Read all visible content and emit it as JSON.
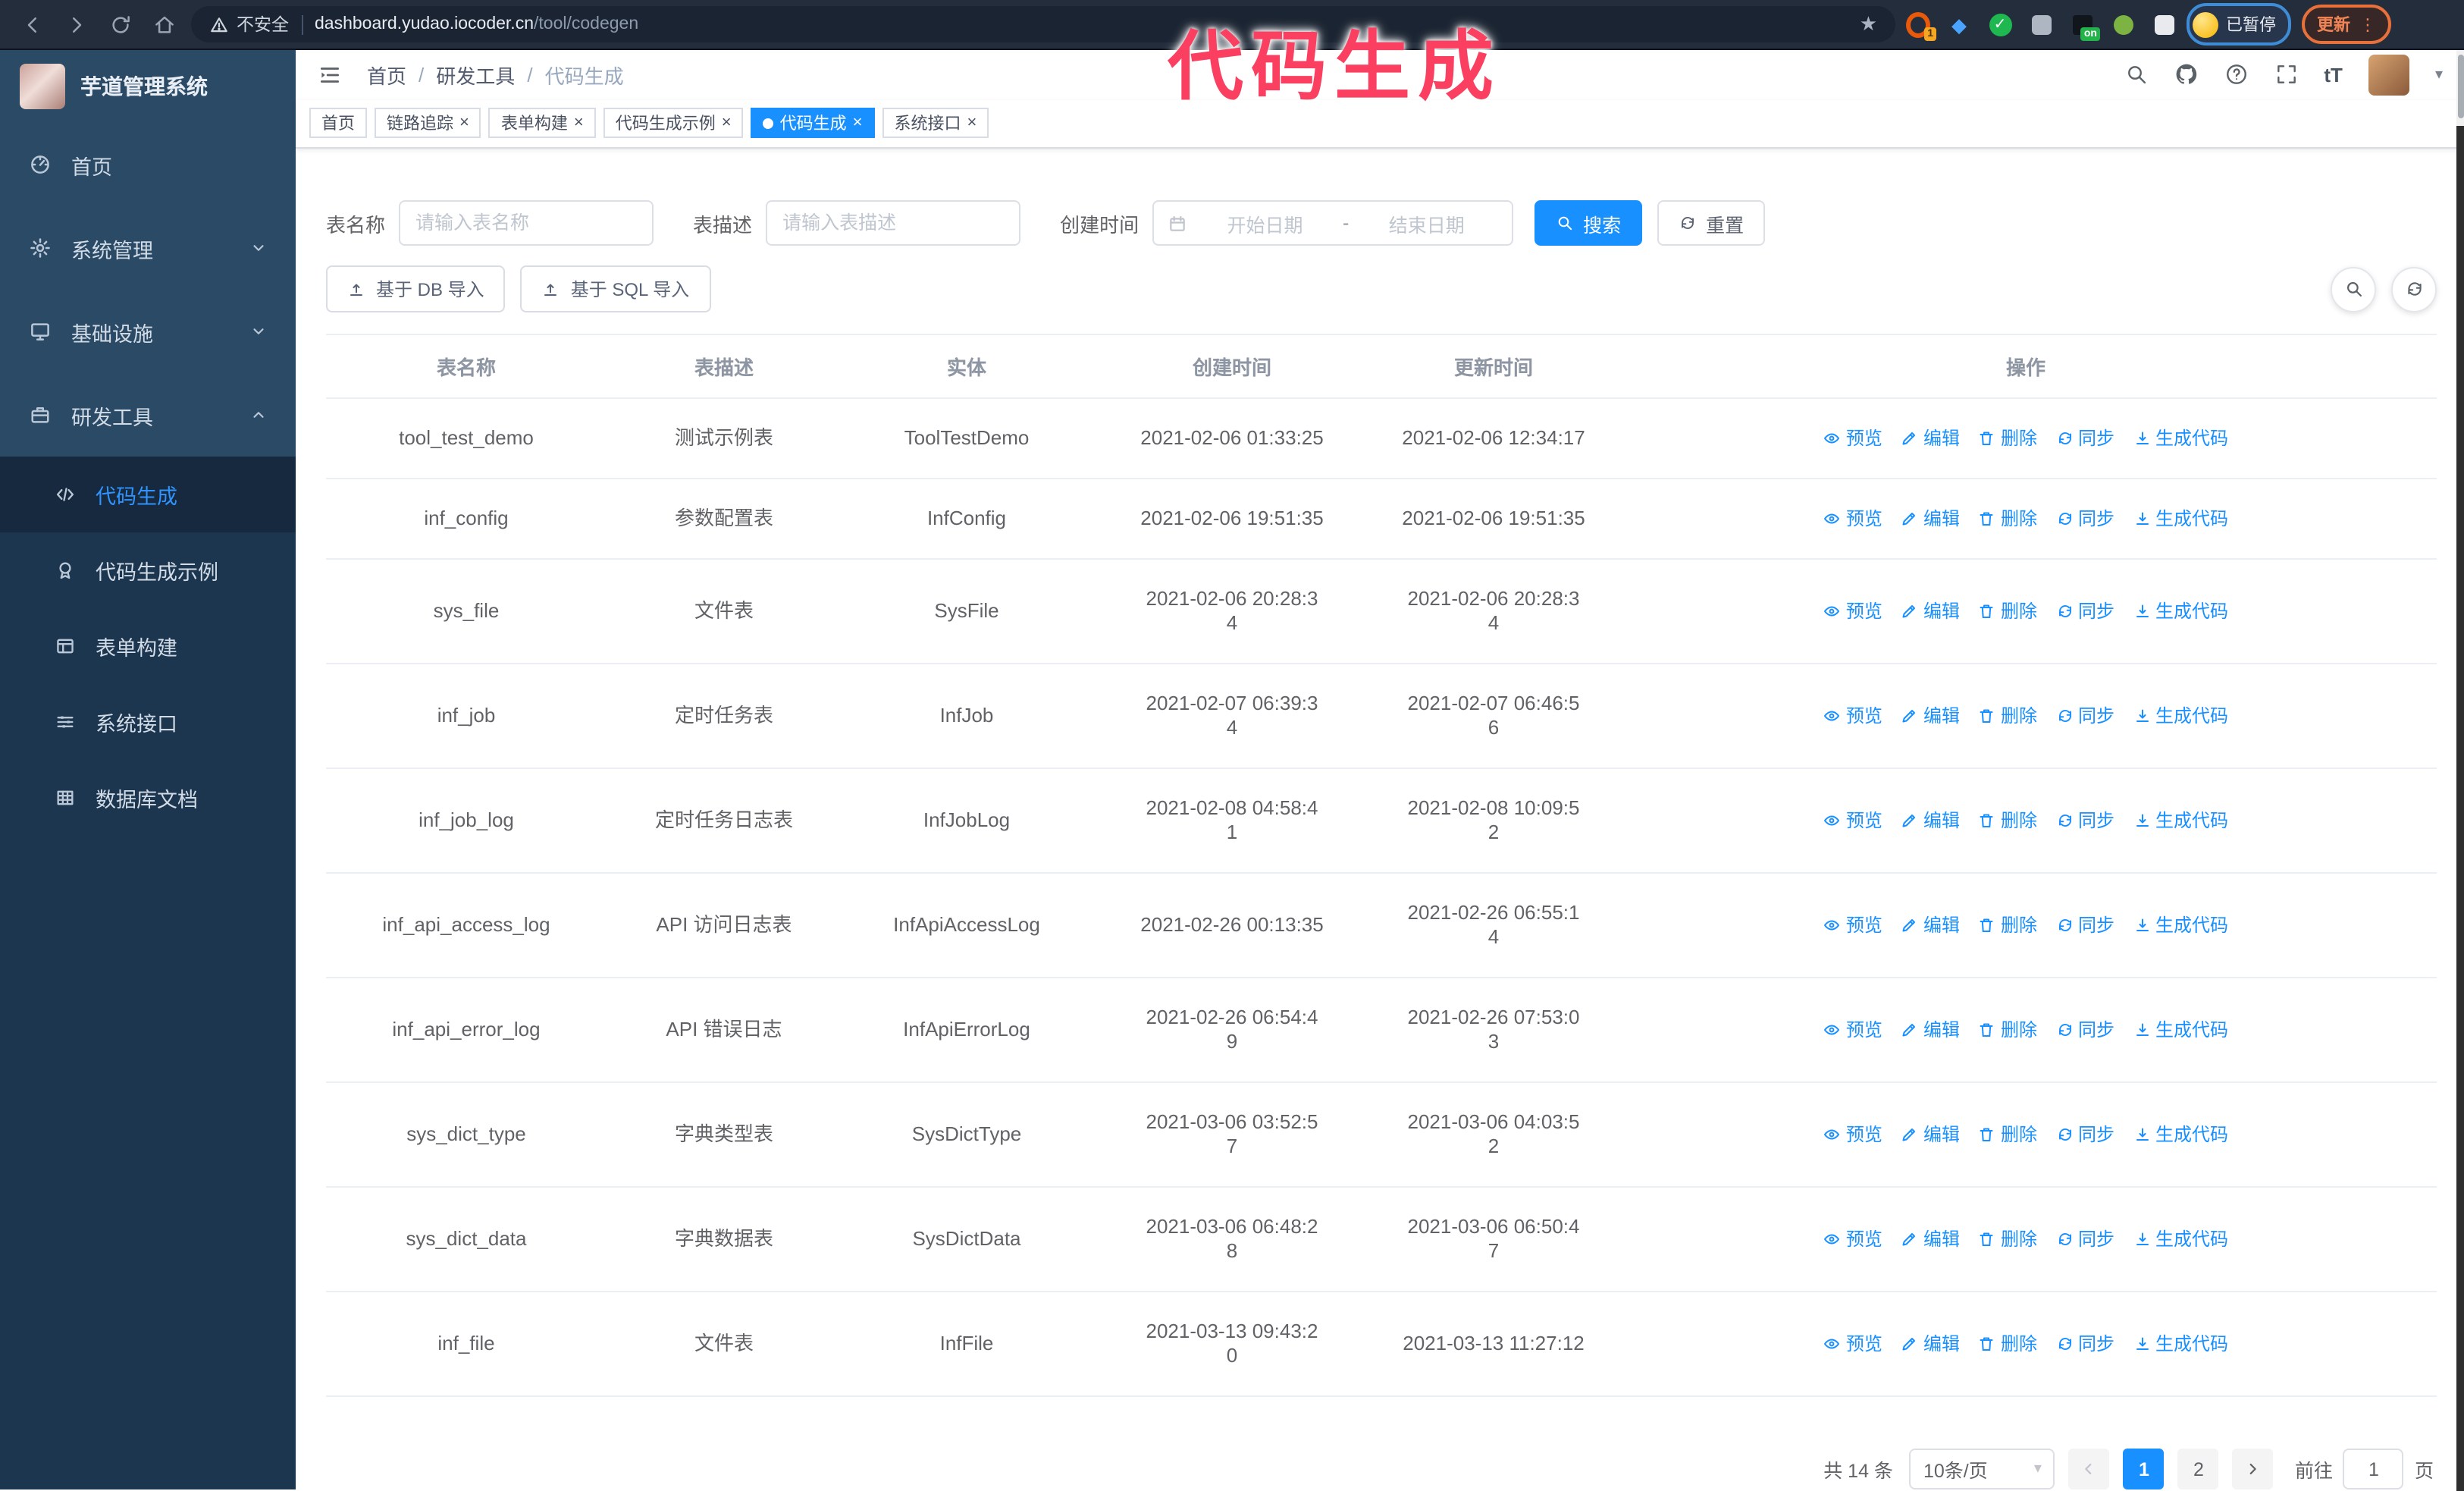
{
  "colors": {
    "accent": "#1890ff",
    "annotation_pink": "#fa3f60",
    "sidebar_bg": "#2b4a66",
    "submenu_bg": "#1d3650",
    "browser_bar": "#232d3c"
  },
  "icons": {
    "close": "×",
    "caret_down": "▾",
    "back_arrow": "←",
    "forward_arrow": "→",
    "star": "★",
    "font_size": "tT",
    "kebab_dots": "⋮",
    "check": "✓",
    "dot_diamond": "◆"
  },
  "browser": {
    "security_warning": "不安全",
    "url_domain": "dashboard.yudao.iocoder.cn",
    "url_path": "/tool/codegen",
    "ext_badge": "1",
    "ext_on_badge": "on",
    "paused_badge": "已暂停",
    "update_button": "更新"
  },
  "annotation": {
    "text": "代码生成"
  },
  "sidebar": {
    "logo_title": "芋道管理系统",
    "items": [
      {
        "label": "首页",
        "icon": "dashboard-icon",
        "chevron": ""
      },
      {
        "label": "系统管理",
        "icon": "gear-icon",
        "chevron": "down"
      },
      {
        "label": "基础设施",
        "icon": "monitor-icon",
        "chevron": "down"
      },
      {
        "label": "研发工具",
        "icon": "toolbox-icon",
        "chevron": "up"
      }
    ],
    "subitems": [
      {
        "label": "代码生成",
        "icon": "code-icon",
        "active": true
      },
      {
        "label": "代码生成示例",
        "icon": "badge-icon",
        "active": false
      },
      {
        "label": "表单构建",
        "icon": "form-icon",
        "active": false
      },
      {
        "label": "系统接口",
        "icon": "api-icon",
        "active": false
      },
      {
        "label": "数据库文档",
        "icon": "database-icon",
        "active": false
      }
    ]
  },
  "header": {
    "breadcrumb": [
      "首页",
      "研发工具",
      "代码生成"
    ],
    "separator": "/"
  },
  "tabs": [
    {
      "label": "首页",
      "closable": false,
      "active": false
    },
    {
      "label": "链路追踪",
      "closable": true,
      "active": false
    },
    {
      "label": "表单构建",
      "closable": true,
      "active": false
    },
    {
      "label": "代码生成示例",
      "closable": true,
      "active": false
    },
    {
      "label": "代码生成",
      "closable": true,
      "active": true
    },
    {
      "label": "系统接口",
      "closable": true,
      "active": false
    }
  ],
  "filters": {
    "table_name_label": "表名称",
    "table_name_placeholder": "请输入表名称",
    "table_desc_label": "表描述",
    "table_desc_placeholder": "请输入表描述",
    "create_time_label": "创建时间",
    "date_start_placeholder": "开始日期",
    "date_separator": "-",
    "date_end_placeholder": "结束日期",
    "search_label": "搜索",
    "reset_label": "重置"
  },
  "toolbar": {
    "import_db": "基于 DB 导入",
    "import_sql": "基于 SQL 导入"
  },
  "table": {
    "columns": [
      "表名称",
      "表描述",
      "实体",
      "创建时间",
      "更新时间",
      "操作"
    ],
    "actions": [
      {
        "label": "预览",
        "icon": "eye-icon"
      },
      {
        "label": "编辑",
        "icon": "edit-icon"
      },
      {
        "label": "删除",
        "icon": "delete-icon"
      },
      {
        "label": "同步",
        "icon": "sync-icon"
      },
      {
        "label": "生成代码",
        "icon": "download-icon"
      }
    ],
    "rows": [
      {
        "name": "tool_test_demo",
        "desc": "测试示例表",
        "entity": "ToolTestDemo",
        "created": [
          "2021-02-06 01:33:25"
        ],
        "updated": [
          "2021-02-06 12:34:17"
        ]
      },
      {
        "name": "inf_config",
        "desc": "参数配置表",
        "entity": "InfConfig",
        "created": [
          "2021-02-06 19:51:35"
        ],
        "updated": [
          "2021-02-06 19:51:35"
        ]
      },
      {
        "name": "sys_file",
        "desc": "文件表",
        "entity": "SysFile",
        "created": [
          "2021-02-06 20:28:3",
          "4"
        ],
        "updated": [
          "2021-02-06 20:28:3",
          "4"
        ]
      },
      {
        "name": "inf_job",
        "desc": "定时任务表",
        "entity": "InfJob",
        "created": [
          "2021-02-07 06:39:3",
          "4"
        ],
        "updated": [
          "2021-02-07 06:46:5",
          "6"
        ]
      },
      {
        "name": "inf_job_log",
        "desc": "定时任务日志表",
        "entity": "InfJobLog",
        "created": [
          "2021-02-08 04:58:4",
          "1"
        ],
        "updated": [
          "2021-02-08 10:09:5",
          "2"
        ]
      },
      {
        "name": "inf_api_access_log",
        "desc": "API 访问日志表",
        "entity": "InfApiAccessLog",
        "created": [
          "2021-02-26 00:13:35"
        ],
        "updated": [
          "2021-02-26 06:55:1",
          "4"
        ]
      },
      {
        "name": "inf_api_error_log",
        "desc": "API 错误日志",
        "entity": "InfApiErrorLog",
        "created": [
          "2021-02-26 06:54:4",
          "9"
        ],
        "updated": [
          "2021-02-26 07:53:0",
          "3"
        ]
      },
      {
        "name": "sys_dict_type",
        "desc": "字典类型表",
        "entity": "SysDictType",
        "created": [
          "2021-03-06 03:52:5",
          "7"
        ],
        "updated": [
          "2021-03-06 04:03:5",
          "2"
        ]
      },
      {
        "name": "sys_dict_data",
        "desc": "字典数据表",
        "entity": "SysDictData",
        "created": [
          "2021-03-06 06:48:2",
          "8"
        ],
        "updated": [
          "2021-03-06 06:50:4",
          "7"
        ]
      },
      {
        "name": "inf_file",
        "desc": "文件表",
        "entity": "InfFile",
        "created": [
          "2021-03-13 09:43:2",
          "0"
        ],
        "updated": [
          "2021-03-13 11:27:12"
        ]
      }
    ]
  },
  "pagination": {
    "total": "共 14 条",
    "page_size": "10条/页",
    "pages": [
      "1",
      "2"
    ],
    "active_page": "1",
    "goto_label": "前往",
    "goto_value": "1",
    "goto_suffix": "页"
  }
}
